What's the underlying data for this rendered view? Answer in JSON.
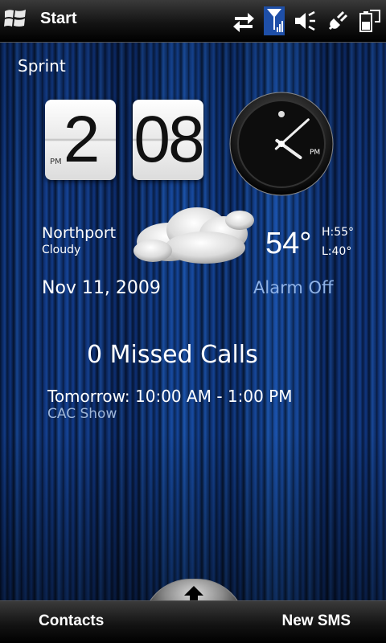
{
  "topbar": {
    "title": "Start",
    "icons": [
      "windows-logo-icon",
      "data-sync-icon",
      "signal-icon",
      "speaker-icon",
      "power-plug-icon",
      "battery-icon"
    ]
  },
  "carrier": "Sprint",
  "clock": {
    "hour": "2",
    "minute": "08",
    "ampm": "PM"
  },
  "analog_clock": {
    "label": "PM",
    "hour_fraction": 0.35,
    "minute_fraction": 0.133
  },
  "weather": {
    "city": "Northport",
    "condition": "Cloudy",
    "temperature": "54°",
    "high": "H:55°",
    "low": "L:40°"
  },
  "date": "Nov 11, 2009",
  "alarm": "Alarm Off",
  "missed_calls": "0 Missed Calls",
  "appointment": {
    "time": "Tomorrow: 10:00 AM - 1:00 PM",
    "title": "CAC Show"
  },
  "softkeys": {
    "left": "Contacts",
    "right": "New SMS"
  },
  "colors": {
    "accent": "#8fb2e6",
    "wallpaper": "#123a86"
  }
}
